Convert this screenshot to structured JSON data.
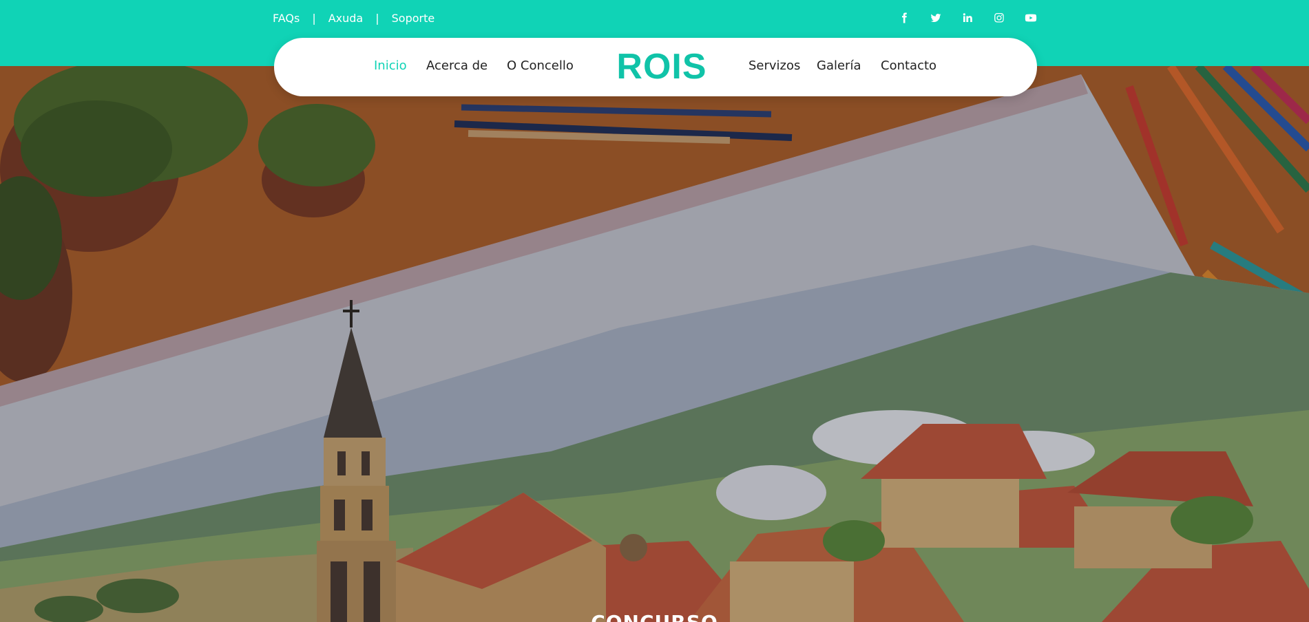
{
  "topbar": {
    "links": [
      "FAQs",
      "Axuda",
      "Soporte"
    ],
    "separator": "|",
    "social_icons": [
      "facebook-icon",
      "twitter-icon",
      "linkedin-icon",
      "instagram-icon",
      "youtube-icon"
    ]
  },
  "nav": {
    "left_items": [
      "Inicio",
      "Acerca de",
      "O Concello"
    ],
    "logo": "ROIS",
    "right_items": [
      "Servizos",
      "Galería",
      "Contacto"
    ],
    "active_item": "Inicio"
  },
  "hero": {
    "title": "CONCURSO"
  },
  "colors": {
    "accent": "#10d3b6",
    "nav_background": "#ffffff",
    "text": "#222222"
  }
}
